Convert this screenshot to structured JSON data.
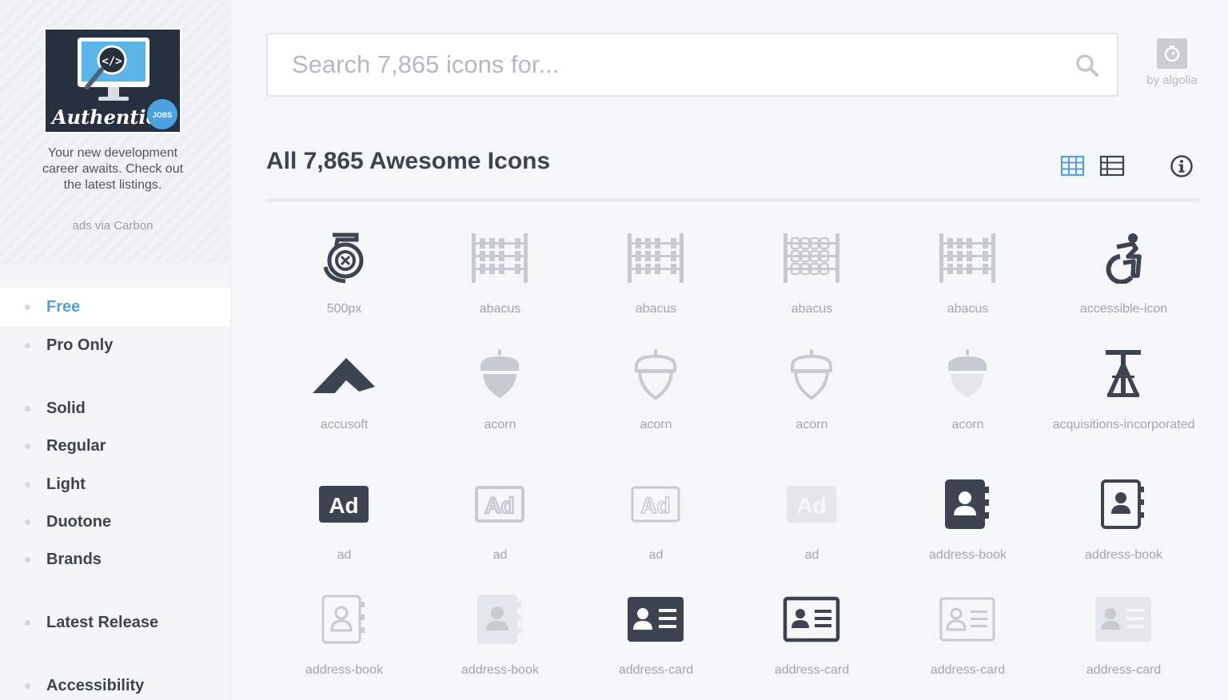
{
  "ad": {
    "logo_text": "Authentic",
    "badge": "JOBS",
    "text": "Your new development career awaits. Check out the latest listings.",
    "via": "ads via Carbon"
  },
  "nav": [
    {
      "label": "Free",
      "active": true
    },
    {
      "label": "Pro Only"
    },
    {
      "label": "Solid"
    },
    {
      "label": "Regular"
    },
    {
      "label": "Light"
    },
    {
      "label": "Duotone"
    },
    {
      "label": "Brands"
    },
    {
      "label": "Latest Release"
    },
    {
      "label": "Accessibility"
    }
  ],
  "search": {
    "placeholder": "Search 7,865 icons for..."
  },
  "algolia": {
    "label": "by algolia"
  },
  "heading": "All 7,865 Awesome Icons",
  "colors": {
    "accent": "#55a0d8",
    "dark": "#3d4451",
    "light": "#c6cad1"
  },
  "icons": [
    {
      "name": "500px",
      "icon": "500px-icon"
    },
    {
      "name": "abacus",
      "icon": "abacus-icon"
    },
    {
      "name": "abacus",
      "icon": "abacus-icon"
    },
    {
      "name": "abacus",
      "icon": "abacus-icon"
    },
    {
      "name": "abacus",
      "icon": "abacus-icon"
    },
    {
      "name": "accessible-icon",
      "icon": "accessible-icon"
    },
    {
      "name": "accusoft",
      "icon": "accusoft-icon"
    },
    {
      "name": "acorn",
      "icon": "acorn-icon"
    },
    {
      "name": "acorn",
      "icon": "acorn-icon"
    },
    {
      "name": "acorn",
      "icon": "acorn-icon"
    },
    {
      "name": "acorn",
      "icon": "acorn-icon"
    },
    {
      "name": "acquisitions-incorporated",
      "icon": "acquisitions-incorporated-icon"
    },
    {
      "name": "ad",
      "icon": "ad-icon"
    },
    {
      "name": "ad",
      "icon": "ad-icon"
    },
    {
      "name": "ad",
      "icon": "ad-icon"
    },
    {
      "name": "ad",
      "icon": "ad-icon"
    },
    {
      "name": "address-book",
      "icon": "address-book-icon"
    },
    {
      "name": "address-book",
      "icon": "address-book-icon"
    },
    {
      "name": "address-book",
      "icon": "address-book-icon"
    },
    {
      "name": "address-book",
      "icon": "address-book-icon"
    },
    {
      "name": "address-card",
      "icon": "address-card-icon"
    },
    {
      "name": "address-card",
      "icon": "address-card-icon"
    },
    {
      "name": "address-card",
      "icon": "address-card-icon"
    },
    {
      "name": "address-card",
      "icon": "address-card-icon"
    }
  ]
}
